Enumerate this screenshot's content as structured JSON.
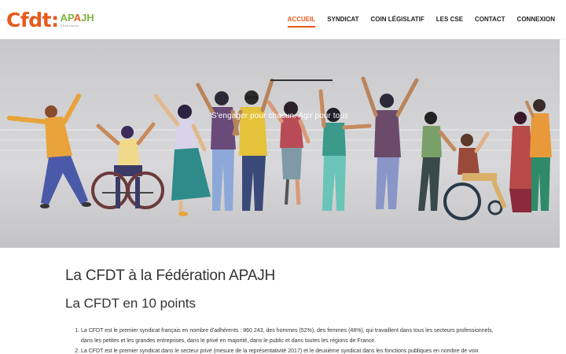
{
  "logo": {
    "brand": "Cfdt:",
    "partner_a1": "AP",
    "partner_a2": "A",
    "partner_a3": "JH",
    "partner_sub": "Fédération"
  },
  "nav": {
    "items": [
      {
        "label": "ACCUEIL",
        "active": true
      },
      {
        "label": "SYNDICAT",
        "active": false
      },
      {
        "label": "COIN LÉGISLATIF",
        "active": false
      },
      {
        "label": "LES CSE",
        "active": false
      },
      {
        "label": "CONTACT",
        "active": false
      },
      {
        "label": "CONNEXION",
        "active": false
      }
    ]
  },
  "hero": {
    "tagline": "S'engager pour chacun. Agir pour tous"
  },
  "main": {
    "title": "La CFDT à la Fédération APAJH",
    "section_title": "La CFDT en 10 points",
    "points": [
      "La CFDT est le premier syndicat français en nombre d'adhérents : 860 243, des hommes (52%), des femmes (48%), qui travaillent dans tous les secteurs professionnels, dans les petites et les grandes entreprises, dans le privé en majorité, dans le public et dans toutes les régions de France.",
      "La CFDT est le premier syndicat dans le secteur privé (mesure de la représentativité 2017) et le deuxième syndicat dans les fonctions publiques en nombre de voix"
    ]
  },
  "colors": {
    "accent": "#e85a1c",
    "brand_green": "#7fb33f",
    "hero_bg": "#cfcfd1"
  }
}
